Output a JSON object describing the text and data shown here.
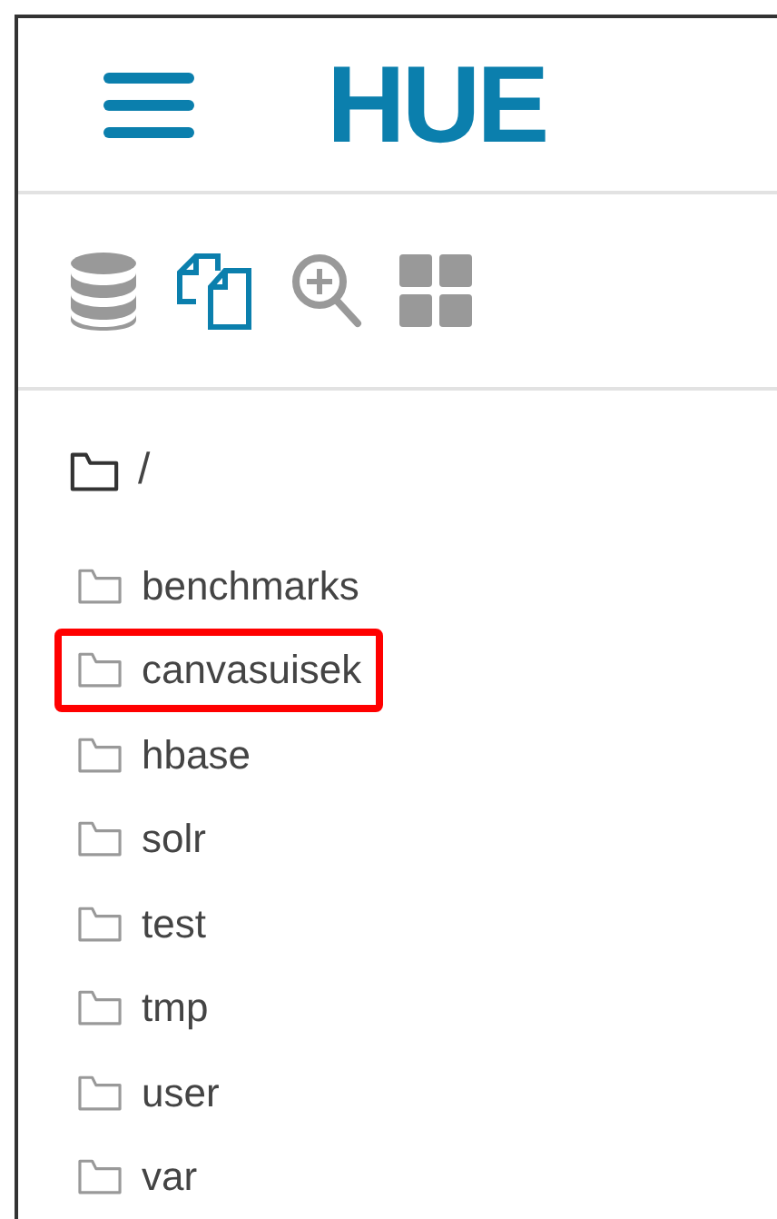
{
  "header": {
    "logo": "HUE"
  },
  "toolbar": [
    {
      "kind": "database",
      "selected": false
    },
    {
      "kind": "files",
      "selected": true
    },
    {
      "kind": "search",
      "selected": false
    },
    {
      "kind": "apps",
      "selected": false
    }
  ],
  "root": {
    "label": "/"
  },
  "folders": [
    {
      "label": "benchmarks",
      "highlighted": false
    },
    {
      "label": "canvasuisek",
      "highlighted": true
    },
    {
      "label": "hbase",
      "highlighted": false
    },
    {
      "label": "solr",
      "highlighted": false
    },
    {
      "label": "test",
      "highlighted": false
    },
    {
      "label": "tmp",
      "highlighted": false
    },
    {
      "label": "user",
      "highlighted": false
    },
    {
      "label": "var",
      "highlighted": false
    }
  ]
}
